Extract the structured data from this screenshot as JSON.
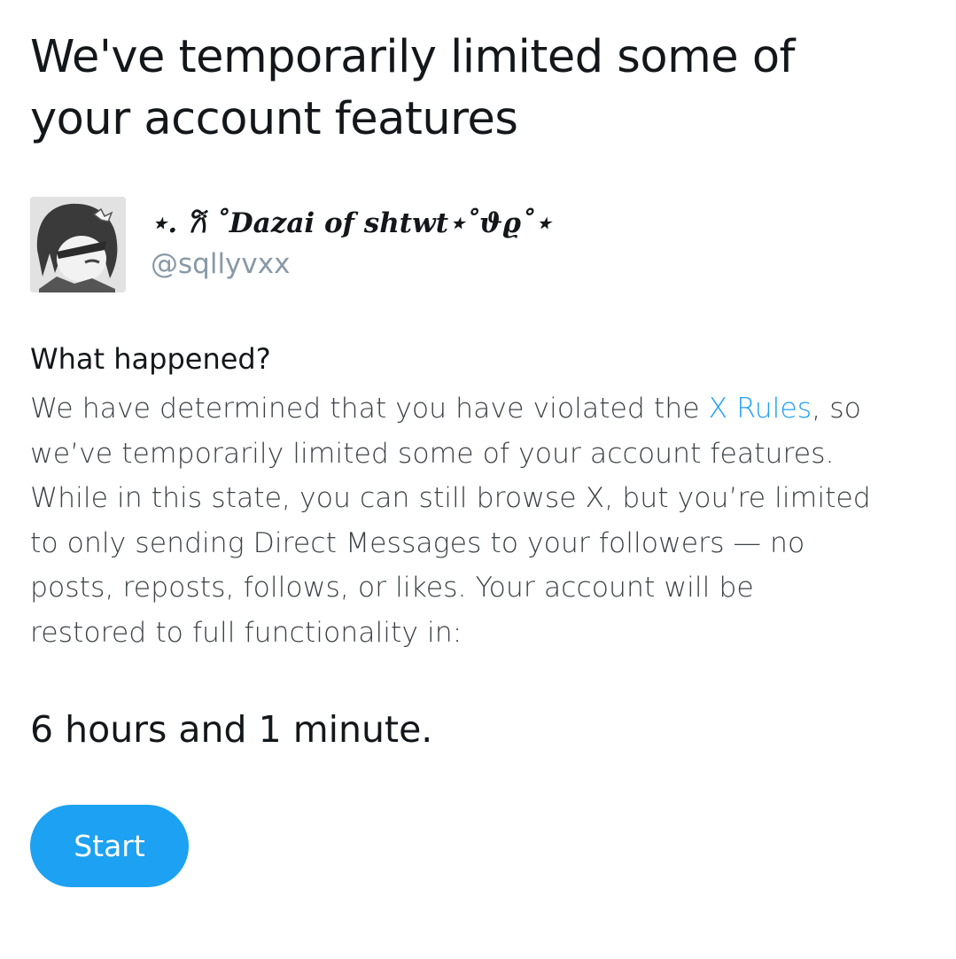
{
  "header": {
    "title_line1": "We've temporarily limited some of",
    "title_line2": "your account features"
  },
  "account": {
    "avatar_icon": "user-avatar-anime-portrait",
    "display_name": "⋆. 𐙚 ˚Dazai of shtwt⋆˚ϑϱ˚⋆",
    "handle": "@sqllyvxx"
  },
  "explanation": {
    "heading": "What happened?",
    "line1_before_link": "We have determined that you have violated the ",
    "link_text": "X Rules",
    "line1_after_link": ", so",
    "line2": "we’ve temporarily limited some of your account features.",
    "line3": "While in this state, you can still browse X, but you’re limited",
    "line4": "to only sending Direct Messages to your followers — no",
    "line5": "posts, reposts, follows, or likes. Your account will be",
    "line6": "restored to full functionality in:"
  },
  "countdown": {
    "text": "6 hours and 1 minute."
  },
  "actions": {
    "start_label": "Start"
  },
  "colors": {
    "accent": "#1da1f2",
    "text_primary": "#14171a",
    "text_secondary": "#8899a6"
  }
}
